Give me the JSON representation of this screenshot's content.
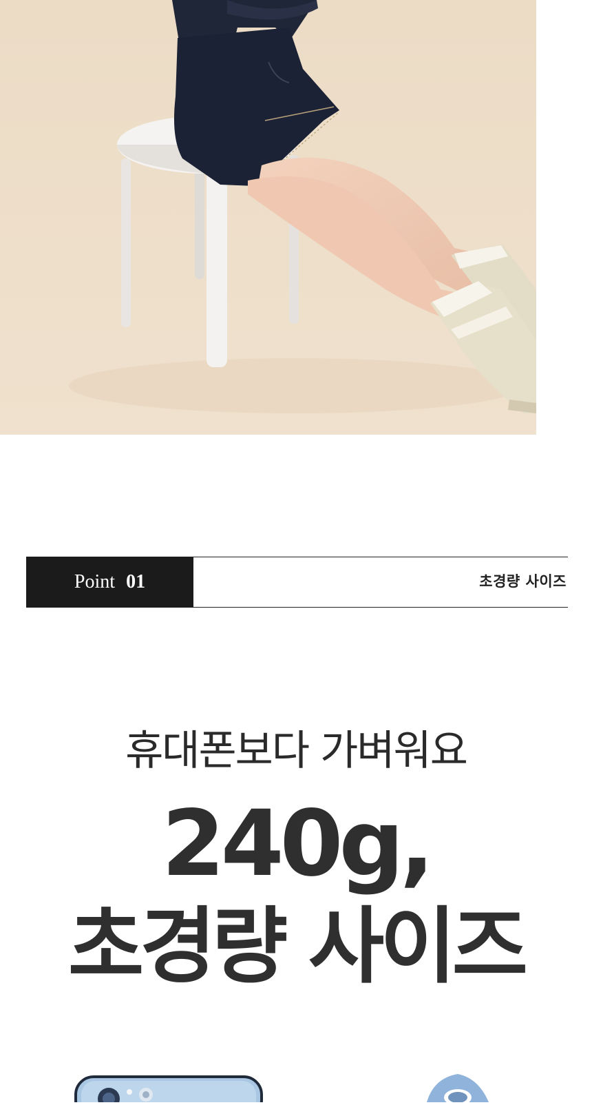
{
  "hero": {
    "image": "model-photo",
    "backdrop_color": "#eddcc6",
    "stool_color": "#f1eeeb",
    "skirt_color": "#1c2235",
    "boot_color": "#e3dcc6"
  },
  "point": {
    "label": "Point",
    "number": "01",
    "title": "초경량 사이즈"
  },
  "copy": {
    "subhead": "휴대폰보다 가벼워요",
    "headline_line1": "240g,",
    "headline_line2": "초경량 사이즈"
  },
  "products": {
    "phone": "phone-image",
    "item": "product-image",
    "phone_color": "#b9d3ea",
    "item_color": "#8fb3db"
  }
}
